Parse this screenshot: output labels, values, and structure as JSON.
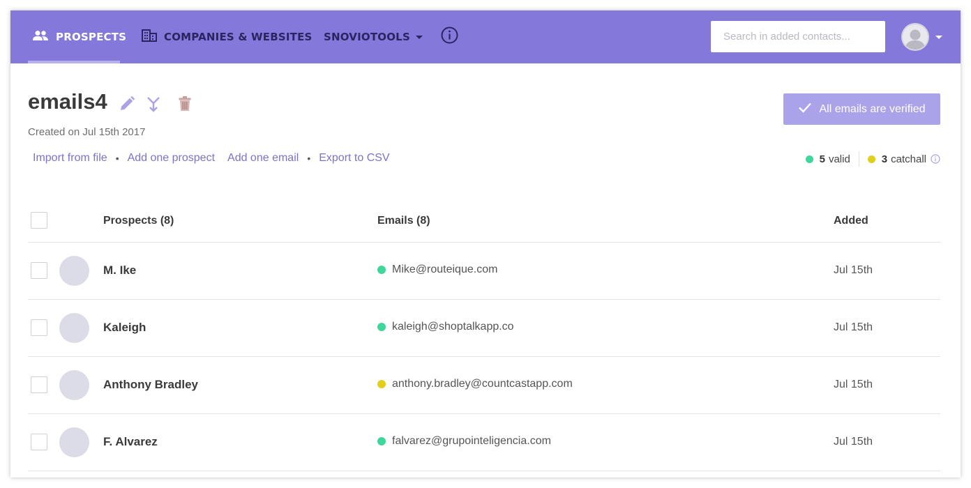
{
  "nav": {
    "prospects": "PROSPECTS",
    "companies": "COMPANIES & WEBSITES",
    "tools": "SNOVIOTOOLS",
    "info_icon": "info-icon",
    "search_placeholder": "Search in added contacts..."
  },
  "header": {
    "title": "emails4",
    "created": "Created on Jul 15th 2017",
    "icons": [
      "pencil-icon",
      "merge-icon",
      "trash-icon"
    ],
    "verified_label": "All emails are verified"
  },
  "actions": {
    "import": "Import from file",
    "add_prospect": "Add one prospect",
    "add_email": "Add one email",
    "export": "Export to CSV"
  },
  "stats": {
    "valid_count": "5",
    "valid_label": "valid",
    "catchall_count": "3",
    "catchall_label": "catchall"
  },
  "table": {
    "col_prospects": "Prospects (8)",
    "col_emails": "Emails (8)",
    "col_added": "Added",
    "rows": [
      {
        "name": "M. Ike",
        "email": "Mike@routeique.com",
        "status": "valid",
        "added": "Jul 15th"
      },
      {
        "name": "Kaleigh",
        "email": "kaleigh@shoptalkapp.co",
        "status": "valid",
        "added": "Jul 15th"
      },
      {
        "name": "Anthony Bradley",
        "email": "anthony.bradley@countcastapp.com",
        "status": "catchall",
        "added": "Jul 15th"
      },
      {
        "name": "F. Alvarez",
        "email": "falvarez@grupointeligencia.com",
        "status": "valid",
        "added": "Jul 15th"
      }
    ]
  },
  "colors": {
    "nav_bg": "#8479da",
    "accent": "#7b73c8",
    "valid": "#3ed69a",
    "catchall": "#e2cf1c",
    "verified_btn": "#aba3ea"
  }
}
